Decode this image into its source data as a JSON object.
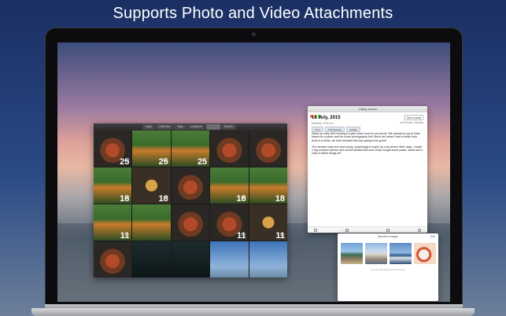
{
  "headline": "Supports Photo and Video Attachments",
  "colors": {
    "accent_blue": "#2a6fd6",
    "close": "#fc605c",
    "minimize": "#fdbc40",
    "zoom": "#34c84a"
  },
  "photo_window": {
    "tabs": [
      "Days",
      "Calendar",
      "Tags",
      "Locations",
      "",
      "Search"
    ],
    "active_tab_index": 4,
    "cells": [
      {
        "kind": "food",
        "day": "SAT",
        "num": "25"
      },
      {
        "kind": "dog",
        "day": "SAT",
        "num": "25"
      },
      {
        "kind": "dog",
        "day": "",
        "num": "25"
      },
      {
        "kind": "food",
        "day": "",
        "num": ""
      },
      {
        "kind": "food",
        "day": "",
        "num": ""
      },
      {
        "kind": "dog",
        "day": "SAT",
        "num": "18"
      },
      {
        "kind": "beer",
        "day": "SAT",
        "num": "18"
      },
      {
        "kind": "food",
        "day": "",
        "num": ""
      },
      {
        "kind": "dog",
        "day": "SAT",
        "num": "18"
      },
      {
        "kind": "dog",
        "day": "",
        "num": "18"
      },
      {
        "kind": "dog",
        "day": "SAT",
        "num": "11"
      },
      {
        "kind": "dog",
        "day": "",
        "num": ""
      },
      {
        "kind": "food",
        "day": "",
        "num": ""
      },
      {
        "kind": "food",
        "day": "SAT",
        "num": "11"
      },
      {
        "kind": "beer",
        "day": "SAT",
        "num": "11"
      },
      {
        "kind": "food",
        "day": "",
        "num": ""
      },
      {
        "kind": "dark",
        "day": "",
        "num": ""
      },
      {
        "kind": "dark",
        "day": "",
        "num": ""
      },
      {
        "kind": "sky",
        "day": "",
        "num": ""
      },
      {
        "kind": "sky",
        "day": "",
        "num": ""
      }
    ]
  },
  "journal": {
    "window_title": "Calling Journal",
    "date": "18 July, 2015",
    "time": "Saturday, 10:00 am",
    "journal_name": "Next Journal",
    "location": "La Perouse, Australia",
    "tags": [
      "Food",
      "Photography",
      "Holiday"
    ],
    "paragraphs": [
      "Woke up early this morning to pack some food for our picnic. We decided to go to Bare Island for a picnic and for some photography fun! Since we haven't had a break from work in a while, we both decided this was going to be great!",
      "The weather was nice and sunny, surprisingly it wasn't as cold as the other days. I made 2 big smoked salmon and rocket sandwiches and Cindy bought some pasta, salad and a cake to finish things off."
    ]
  },
  "attached": {
    "title": "Attached Images",
    "edit_label": "Edit",
    "hint": "You can also drag & drop files here",
    "thumbs": [
      "harbor",
      "town",
      "boats",
      "food"
    ]
  }
}
